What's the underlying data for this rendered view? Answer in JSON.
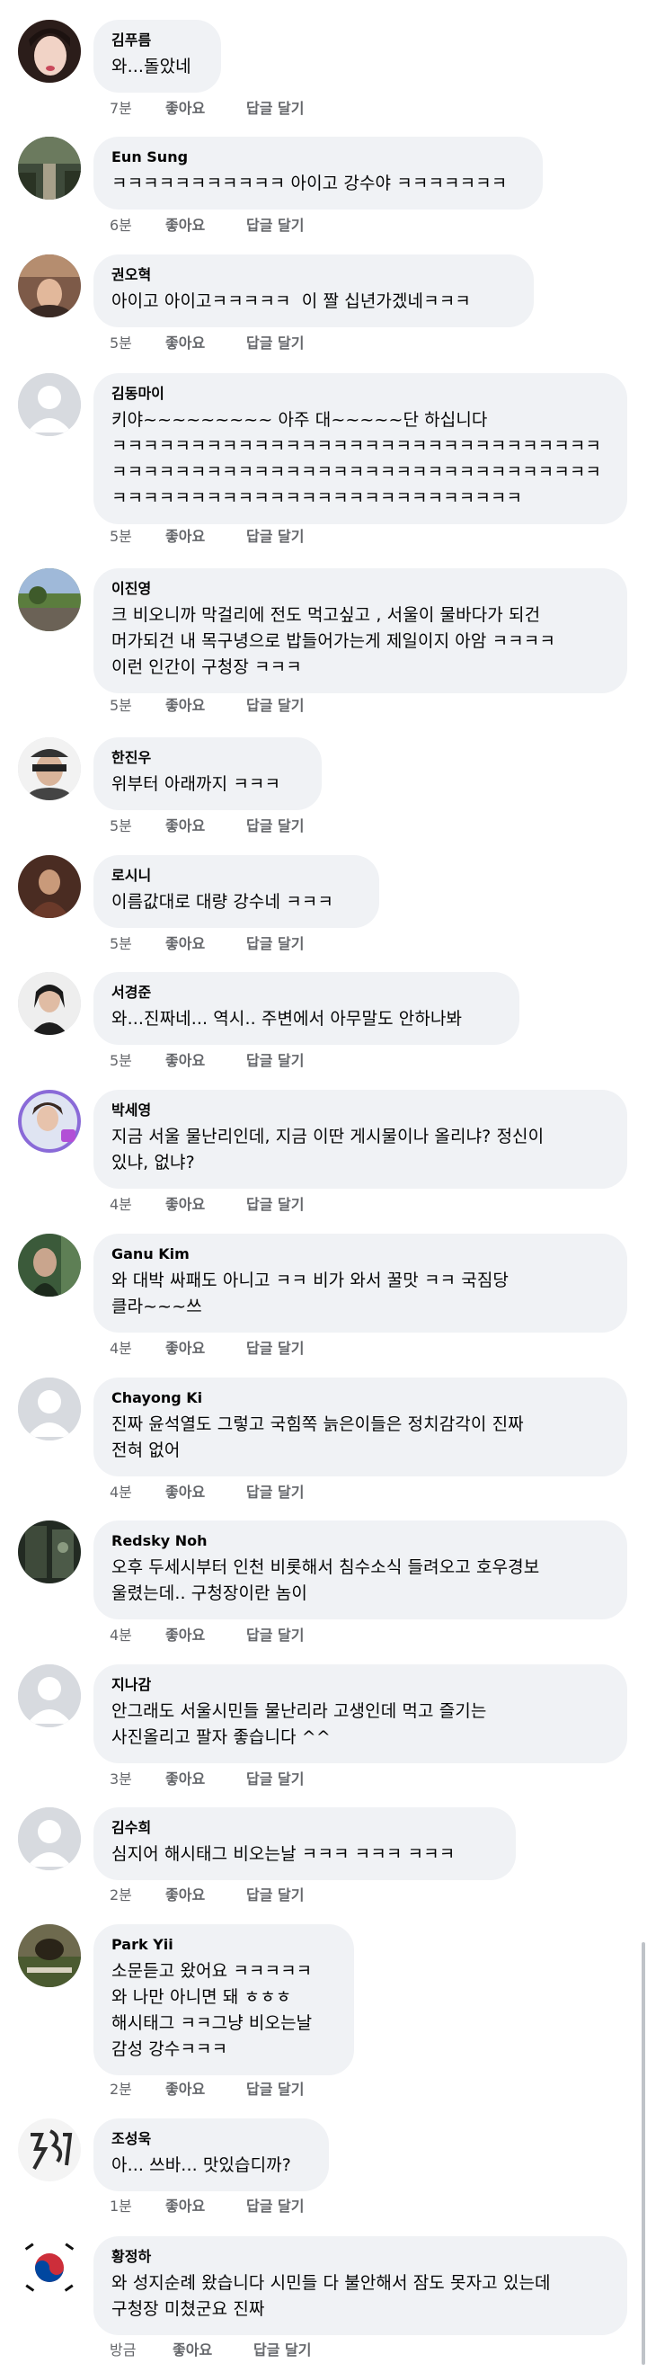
{
  "comments": [
    {
      "name": "김푸름",
      "text": "와...돌았네",
      "time": "7분",
      "like": "좋아요",
      "reply": "답글 달기"
    },
    {
      "name": "Eun Sung",
      "text": "ㅋㅋㅋㅋㅋㅋㅋㅋㅋㅋㅋ 아이고 강수야 ㅋㅋㅋㅋㅋㅋㅋ",
      "time": "6분",
      "like": "좋아요",
      "reply": "답글 달기"
    },
    {
      "name": "권오혁",
      "text": "아이고 아이고ㅋㅋㅋㅋㅋ  이 짤 십년가겠네ㅋㅋㅋ",
      "time": "5분",
      "like": "좋아요",
      "reply": "답글 달기"
    },
    {
      "name": "김동마이",
      "text": "키야~~~~~~~~~ 아주 대~~~~~단 하십니다\nㅋㅋㅋㅋㅋㅋㅋㅋㅋㅋㅋㅋㅋㅋㅋㅋㅋㅋㅋㅋㅋㅋㅋㅋㅋㅋㅋㅋㅋㅋㅋ\nㅋㅋㅋㅋㅋㅋㅋㅋㅋㅋㅋㅋㅋㅋㅋㅋㅋㅋㅋㅋㅋㅋㅋㅋㅋㅋㅋㅋㅋㅋㅋ\nㅋㅋㅋㅋㅋㅋㅋㅋㅋㅋㅋㅋㅋㅋㅋㅋㅋㅋㅋㅋㅋㅋㅋㅋㅋㅋ",
      "time": "5분",
      "like": "좋아요",
      "reply": "답글 달기"
    },
    {
      "name": "이진영",
      "text": "크 비오니까 막걸리에 전도 먹고싶고 , 서울이 물바다가 되건\n머가되건 내 목구녕으로 밥들어가는게 제일이지 아암 ㅋㅋㅋㅋ\n이런 인간이 구청장 ㅋㅋㅋ",
      "time": "5분",
      "like": "좋아요",
      "reply": "답글 달기"
    },
    {
      "name": "한진우",
      "text": "위부터 아래까지 ㅋㅋㅋ",
      "time": "5분",
      "like": "좋아요",
      "reply": "답글 달기"
    },
    {
      "name": "로시니",
      "text": "이름값대로 대량 강수네 ㅋㅋㅋ",
      "time": "5분",
      "like": "좋아요",
      "reply": "답글 달기"
    },
    {
      "name": "서경준",
      "text": "와...진짜네... 역시.. 주변에서 아무말도 안하나봐",
      "time": "5분",
      "like": "좋아요",
      "reply": "답글 달기"
    },
    {
      "name": "박세영",
      "text": "지금 서울 물난리인데, 지금 이딴 게시물이나 올리냐? 정신이\n있냐, 없냐?",
      "time": "4분",
      "like": "좋아요",
      "reply": "답글 달기"
    },
    {
      "name": "Ganu Kim",
      "text": "와 대박 싸패도 아니고 ㅋㅋ 비가 와서 꿀맛 ㅋㅋ 국짐당\n클라~~~쓰",
      "time": "4분",
      "like": "좋아요",
      "reply": "답글 달기"
    },
    {
      "name": "Chayong Ki",
      "text": "진짜 윤석열도 그렇고 국힘쪽 늙은이들은 정치감각이 진짜\n전혀 없어",
      "time": "4분",
      "like": "좋아요",
      "reply": "답글 달기"
    },
    {
      "name": "Redsky Noh",
      "text": "오후 두세시부터 인천 비롯해서 침수소식 들려오고 호우경보\n울렸는데.. 구청장이란 놈이",
      "time": "4분",
      "like": "좋아요",
      "reply": "답글 달기"
    },
    {
      "name": "지나감",
      "text": "안그래도 서울시민들 물난리라 고생인데 먹고 즐기는\n사진올리고 팔자 좋습니다 ^^",
      "time": "3분",
      "like": "좋아요",
      "reply": "답글 달기"
    },
    {
      "name": "김수희",
      "text": "심지어 해시태그 비오는날 ㅋㅋㅋ ㅋㅋㅋ ㅋㅋㅋ",
      "time": "2분",
      "like": "좋아요",
      "reply": "답글 달기"
    },
    {
      "name": "Park Yii",
      "text": "소문듣고 왔어요 ㅋㅋㅋㅋㅋ\n와 나만 아니면 돼 ㅎㅎㅎ\n해시태그 ㅋㅋ그냥 비오는날\n감성 강수ㅋㅋㅋ",
      "time": "2분",
      "like": "좋아요",
      "reply": "답글 달기"
    },
    {
      "name": "조성욱",
      "text": "아... 쓰바... 맛있습디까?",
      "time": "1분",
      "like": "좋아요",
      "reply": "답글 달기"
    },
    {
      "name": "황정하",
      "text": "와 성지순례 왔습니다 시민들 다 불안해서 잠도 못자고 있는데\n구청장 미쳤군요 진짜",
      "time": "방금",
      "like": "좋아요",
      "reply": "답글 달기"
    }
  ]
}
